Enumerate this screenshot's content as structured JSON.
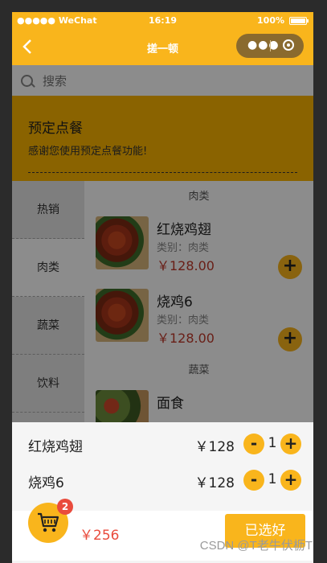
{
  "status_bar": {
    "carrier": "●●●●● WeChat",
    "time": "16:19",
    "battery": "100%"
  },
  "nav": {
    "title": "搓一顿",
    "back_icon": "chevron-left-icon",
    "more_icon": "more-dots-icon",
    "close_icon": "target-circle-icon"
  },
  "search": {
    "placeholder": "搜索"
  },
  "banner": {
    "title": "预定点餐",
    "subtitle": "感谢您使用预定点餐功能!"
  },
  "sidebar": {
    "items": [
      {
        "label": "热销"
      },
      {
        "label": "肉类"
      },
      {
        "label": "蔬菜"
      },
      {
        "label": "饮料"
      }
    ]
  },
  "menu": {
    "sections": [
      {
        "title": "肉类"
      },
      {
        "title": "蔬菜"
      }
    ],
    "dishes": [
      {
        "name": "红烧鸡翅",
        "category": "类别：肉类",
        "price": "￥128.00"
      },
      {
        "name": "烧鸡6",
        "category": "类别：肉类",
        "price": "￥128.00"
      },
      {
        "name": "面食",
        "category": "",
        "price": ""
      }
    ]
  },
  "cart": {
    "items": [
      {
        "name": "红烧鸡翅",
        "price": "￥128",
        "quantity": "1"
      },
      {
        "name": "烧鸡6",
        "price": "￥128",
        "quantity": "1"
      }
    ],
    "minus_label": "-",
    "plus_label": "+",
    "badge_count": "2",
    "total": "￥256",
    "confirm_label": "已选好"
  },
  "watermark": "CSDN @T老牛伏枥T",
  "colors": {
    "accent": "#f9b51c",
    "price": "#c0392b",
    "badge": "#e94b3c"
  }
}
